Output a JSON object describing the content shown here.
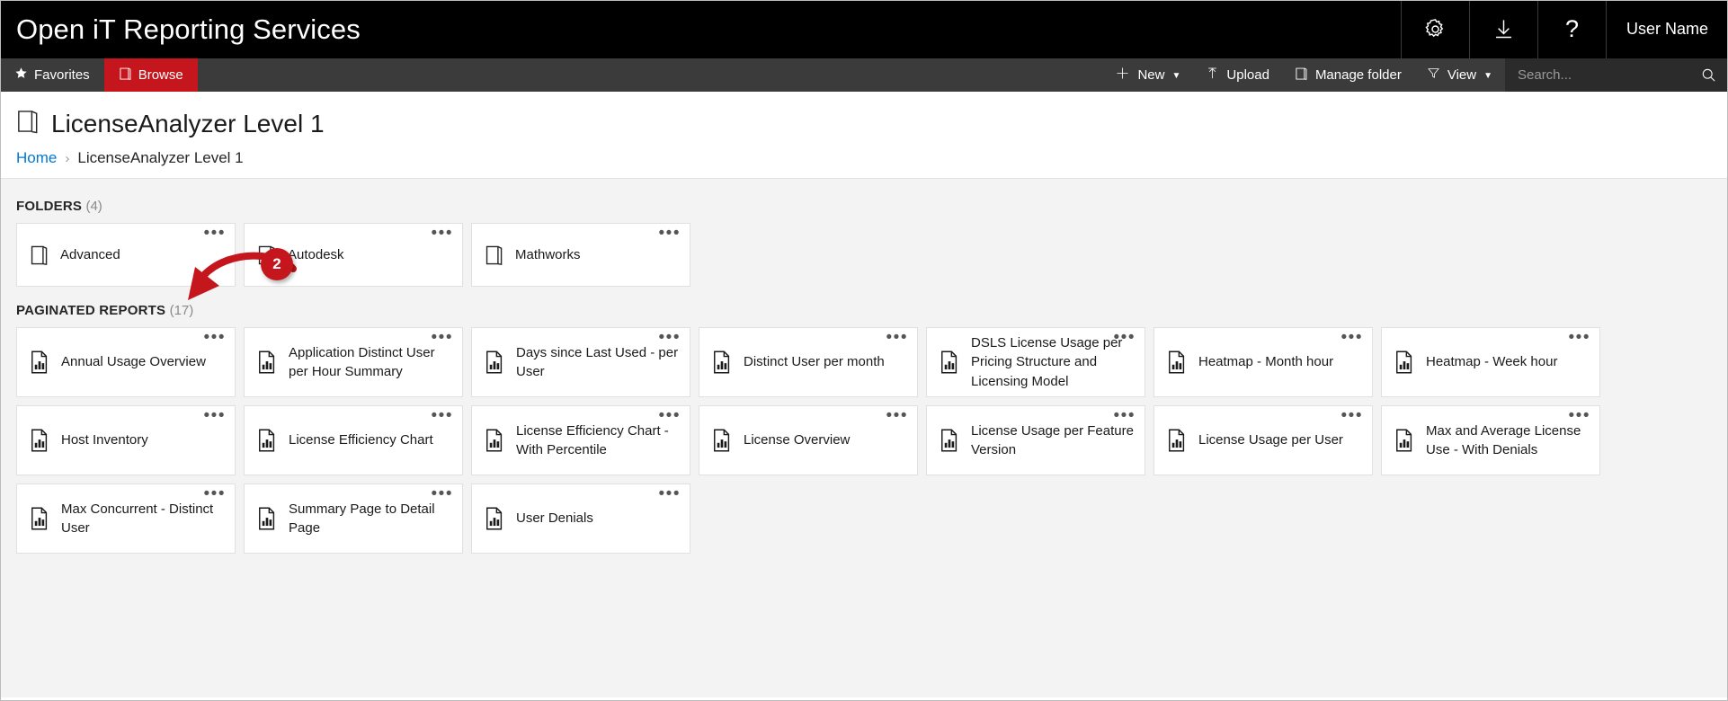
{
  "header": {
    "app_title": "Open iT Reporting Services",
    "actions": [
      {
        "name": "settings",
        "icon": "gear-icon",
        "label": ""
      },
      {
        "name": "downloads",
        "icon": "download-icon",
        "label": ""
      },
      {
        "name": "help",
        "icon": "question-mark-icon",
        "label": "?"
      }
    ],
    "user_name": "User Name"
  },
  "navbar": {
    "tabs": [
      {
        "label": "Favorites",
        "icon": "star-icon",
        "active": false
      },
      {
        "label": "Browse",
        "icon": "folder-icon",
        "active": true
      }
    ],
    "tools": [
      {
        "label": "New",
        "icon": "plus-icon",
        "caret": true
      },
      {
        "label": "Upload",
        "icon": "upload-arrow-icon",
        "caret": false
      },
      {
        "label": "Manage folder",
        "icon": "folder-icon",
        "caret": false
      },
      {
        "label": "View",
        "icon": "filter-icon",
        "caret": true
      }
    ],
    "search": {
      "placeholder": "Search...",
      "value": ""
    }
  },
  "page": {
    "title": "LicenseAnalyzer Level 1",
    "breadcrumb": {
      "home": "Home",
      "separator": "›",
      "current": "LicenseAnalyzer Level 1"
    }
  },
  "folders_section": {
    "heading": "FOLDERS",
    "count": "(4)",
    "items": [
      {
        "label": "Advanced"
      },
      {
        "label": "Autodesk"
      },
      {
        "label": "Mathworks"
      }
    ]
  },
  "reports_section": {
    "heading": "PAGINATED REPORTS",
    "count": "(17)",
    "items": [
      {
        "label": "Annual Usage Overview"
      },
      {
        "label": "Application Distinct User per Hour Summary"
      },
      {
        "label": "Days since Last Used - per User"
      },
      {
        "label": "Distinct User per month"
      },
      {
        "label": "DSLS License Usage per Pricing Structure and Licensing Model"
      },
      {
        "label": "Heatmap - Month hour"
      },
      {
        "label": "Heatmap - Week hour"
      },
      {
        "label": "Host Inventory"
      },
      {
        "label": "License Efficiency Chart"
      },
      {
        "label": "License Efficiency Chart - With Percentile"
      },
      {
        "label": "License Overview"
      },
      {
        "label": "License Usage per Feature Version"
      },
      {
        "label": "License Usage per User"
      },
      {
        "label": "Max and Average License Use - With Denials"
      },
      {
        "label": "Max Concurrent - Distinct User"
      },
      {
        "label": "Summary Page to Detail Page"
      },
      {
        "label": "User Denials"
      }
    ]
  },
  "annotation": {
    "badge_number": "2"
  },
  "ellipsis": "•••",
  "colors": {
    "brand_red": "#c4161c",
    "header_black": "#000000",
    "navbar_gray": "#3b3b3b",
    "content_gray": "#f3f3f3",
    "link_blue": "#0078d4"
  }
}
